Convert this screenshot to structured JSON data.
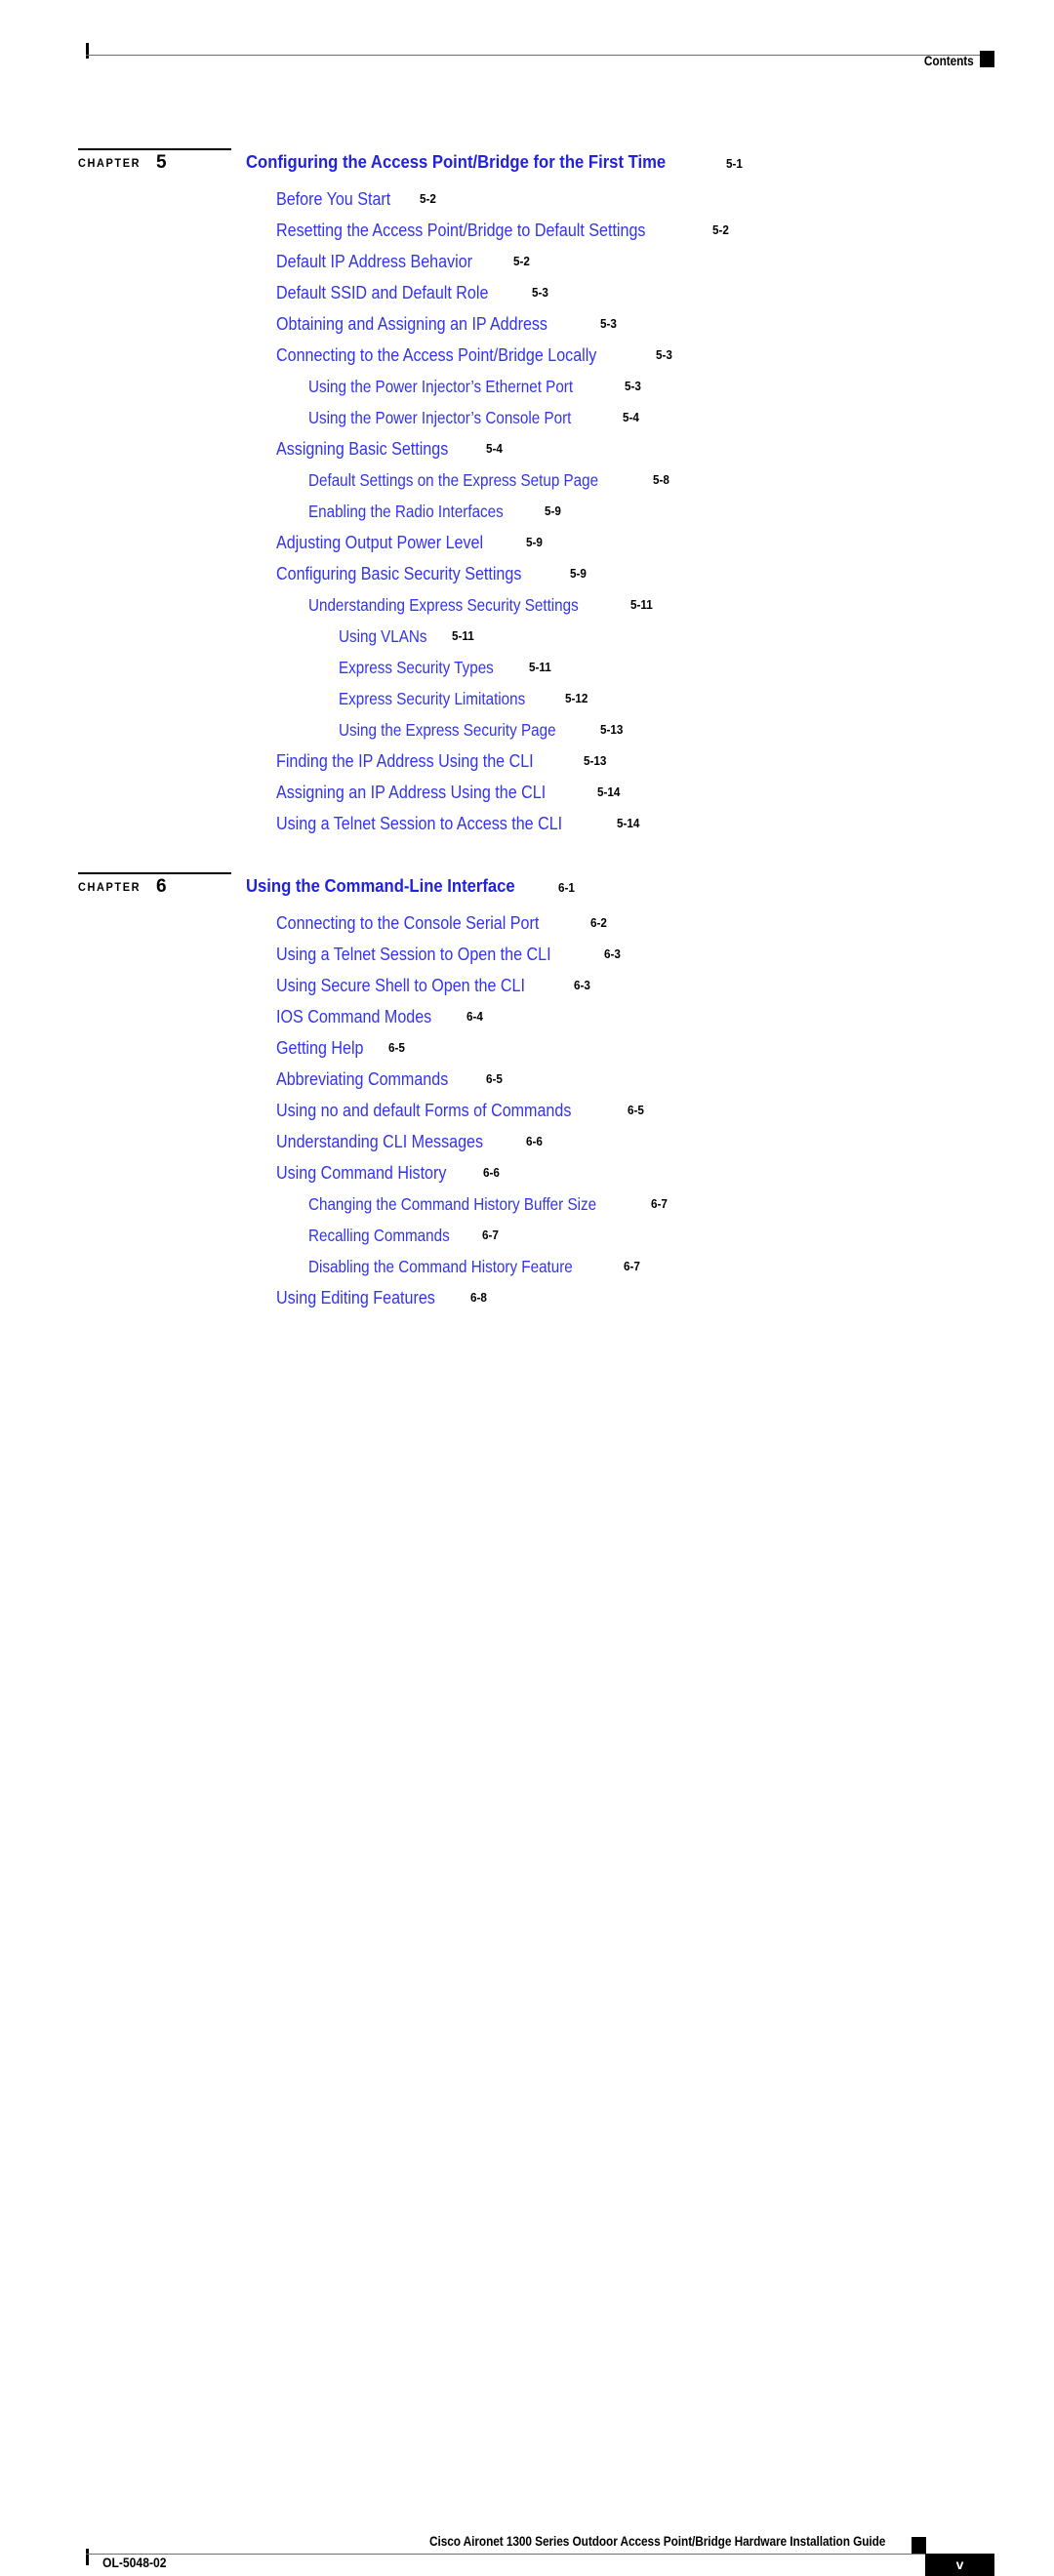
{
  "header": {
    "title": "Contents",
    "marker_icon": "square-marker-icon"
  },
  "footer": {
    "doc_title": "Cisco Aironet 1300 Series Outdoor Access Point/Bridge Hardware Installation Guide",
    "doc_id": "OL-5048-02",
    "page_number": "v",
    "marker_icon": "square-marker-icon"
  },
  "chapters": [
    {
      "label": "CHAPTER",
      "number": "5",
      "title": "Configuring the Access Point/Bridge for the First Time",
      "page": "5-1",
      "entries": [
        {
          "level": 1,
          "text": "Before You Start",
          "page": "5-2"
        },
        {
          "level": 1,
          "text": "Resetting the Access Point/Bridge to Default Settings",
          "page": "5-2"
        },
        {
          "level": 1,
          "text": "Default IP Address Behavior",
          "page": "5-2"
        },
        {
          "level": 1,
          "text": "Default SSID and Default Role",
          "page": "5-3"
        },
        {
          "level": 1,
          "text": "Obtaining and Assigning an IP Address",
          "page": "5-3"
        },
        {
          "level": 1,
          "text": "Connecting to the Access Point/Bridge Locally",
          "page": "5-3"
        },
        {
          "level": 2,
          "text": "Using the Power Injector’s Ethernet Port",
          "page": "5-3"
        },
        {
          "level": 2,
          "text": "Using the Power Injector’s Console Port",
          "page": "5-4"
        },
        {
          "level": 1,
          "text": "Assigning Basic Settings",
          "page": "5-4"
        },
        {
          "level": 2,
          "text": "Default Settings on the Express Setup Page",
          "page": "5-8"
        },
        {
          "level": 2,
          "text": "Enabling the Radio Interfaces",
          "page": "5-9"
        },
        {
          "level": 1,
          "text": "Adjusting Output Power Level",
          "page": "5-9"
        },
        {
          "level": 1,
          "text": "Configuring Basic Security Settings",
          "page": "5-9"
        },
        {
          "level": 2,
          "text": "Understanding Express Security Settings",
          "page": "5-11"
        },
        {
          "level": 3,
          "text": "Using VLANs",
          "page": "5-11"
        },
        {
          "level": 3,
          "text": "Express Security Types",
          "page": "5-11"
        },
        {
          "level": 3,
          "text": "Express Security Limitations",
          "page": "5-12"
        },
        {
          "level": 3,
          "text": "Using the Express Security Page",
          "page": "5-13"
        },
        {
          "level": 1,
          "text": "Finding the IP Address Using the CLI",
          "page": "5-13"
        },
        {
          "level": 1,
          "text": "Assigning an IP Address Using the CLI",
          "page": "5-14"
        },
        {
          "level": 1,
          "text": "Using a Telnet Session to Access the CLI",
          "page": "5-14"
        }
      ]
    },
    {
      "label": "CHAPTER",
      "number": "6",
      "title": "Using the Command-Line Interface",
      "page": "6-1",
      "entries": [
        {
          "level": 1,
          "text": "Connecting to the Console Serial Port",
          "page": "6-2"
        },
        {
          "level": 1,
          "text": "Using a Telnet Session to Open the CLI",
          "page": "6-3"
        },
        {
          "level": 1,
          "text": "Using Secure Shell to Open the CLI",
          "page": "6-3"
        },
        {
          "level": 1,
          "text": "IOS Command Modes",
          "page": "6-4"
        },
        {
          "level": 1,
          "text": "Getting Help",
          "page": "6-5"
        },
        {
          "level": 1,
          "text": "Abbreviating Commands",
          "page": "6-5"
        },
        {
          "level": 1,
          "text": "Using no and default Forms of Commands",
          "page": "6-5"
        },
        {
          "level": 1,
          "text": "Understanding CLI Messages",
          "page": "6-6"
        },
        {
          "level": 1,
          "text": "Using Command History",
          "page": "6-6"
        },
        {
          "level": 2,
          "text": "Changing the Command History Buffer Size",
          "page": "6-7"
        },
        {
          "level": 2,
          "text": "Recalling Commands",
          "page": "6-7"
        },
        {
          "level": 2,
          "text": "Disabling the Command History Feature",
          "page": "6-7"
        },
        {
          "level": 1,
          "text": "Using Editing Features",
          "page": "6-8"
        }
      ]
    }
  ],
  "colors": {
    "link_blue": "#3333ee",
    "heading_blue": "#2222dd",
    "rule_gray": "#6e6e6e",
    "marker_black": "#000000"
  }
}
